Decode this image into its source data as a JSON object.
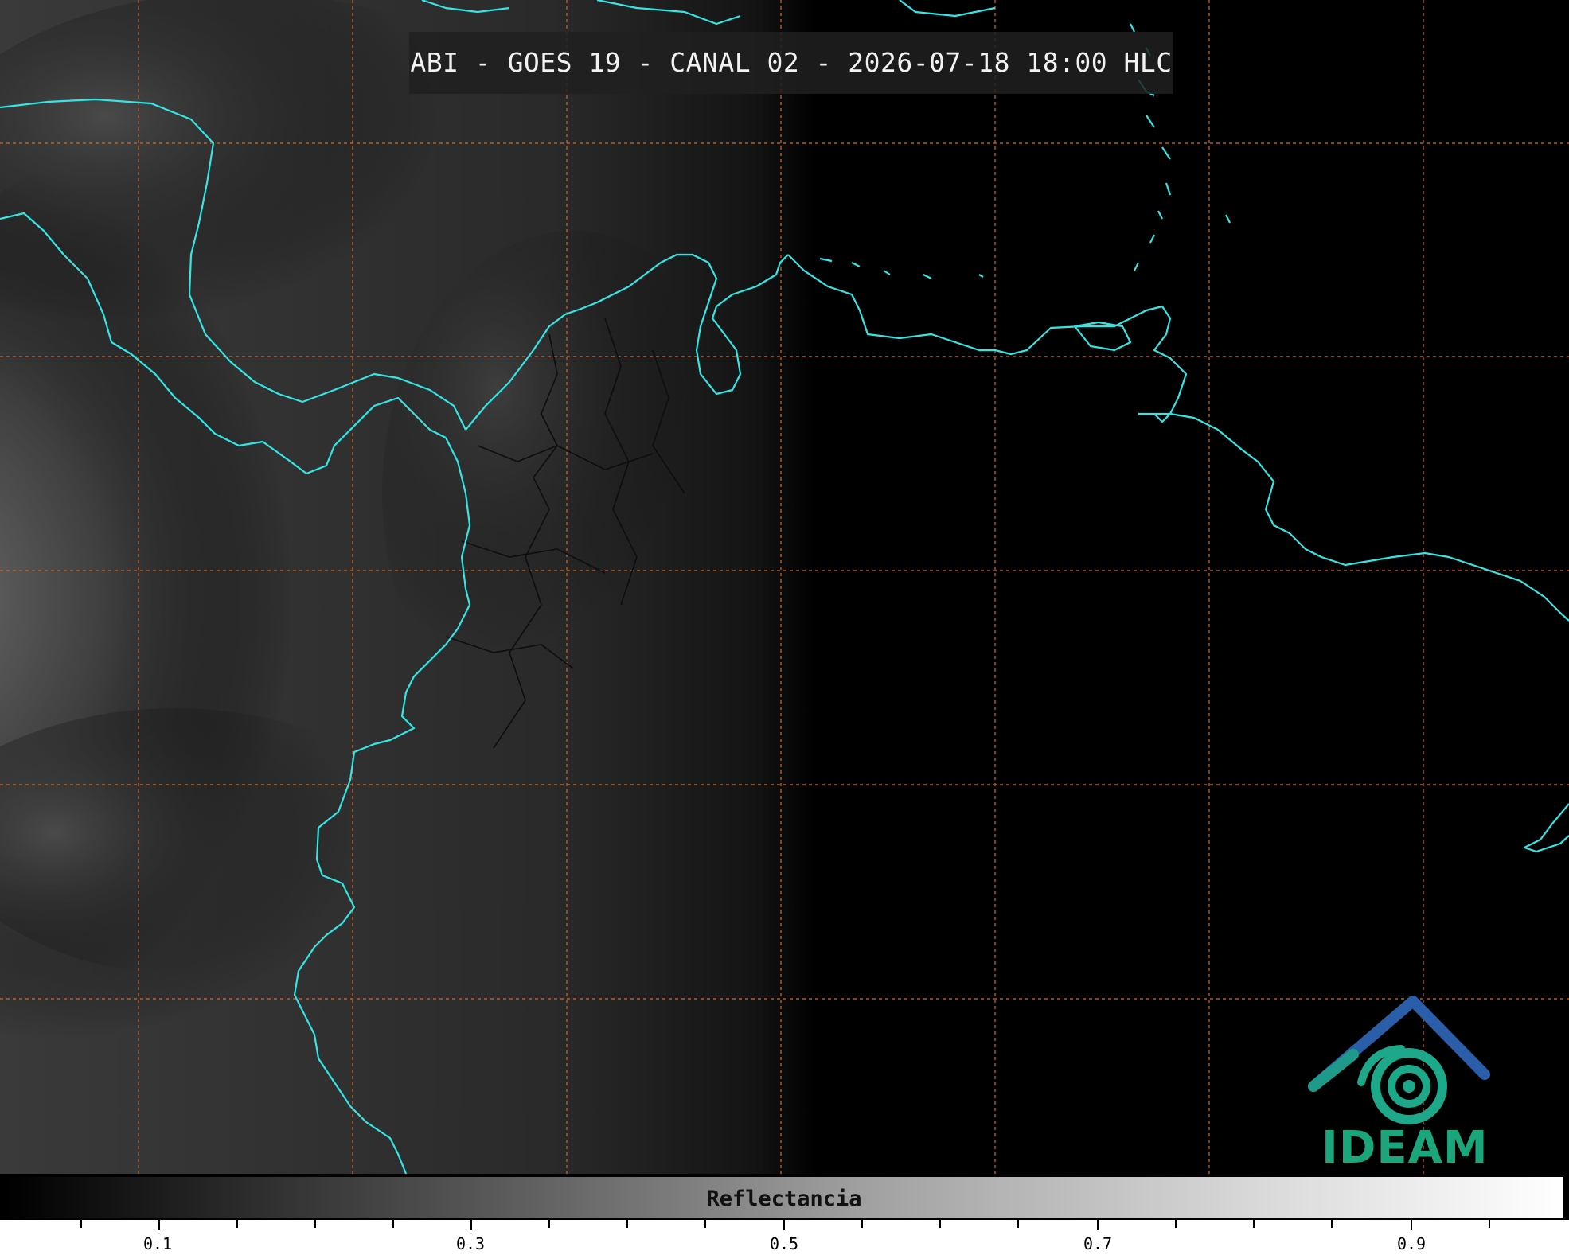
{
  "title": "ABI - GOES 19 - CANAL 02 - 2026-07-18 18:00 HLC",
  "logo_text": "IDEAM",
  "colorbar": {
    "label": "Reflectancia",
    "ticks": [
      "0.1",
      "0.3",
      "0.5",
      "0.7",
      "0.9"
    ],
    "tick_values": [
      0.1,
      0.3,
      0.5,
      0.7,
      0.9
    ],
    "range": [
      0.0,
      1.0
    ],
    "gradient": [
      "#000000",
      "#ffffff"
    ]
  },
  "colors": {
    "coastline": "#33e6e6",
    "gridline": "#c8642a",
    "borders": "#111111",
    "logo_blue": "#2a5ea8",
    "logo_green": "#1aa57a"
  }
}
